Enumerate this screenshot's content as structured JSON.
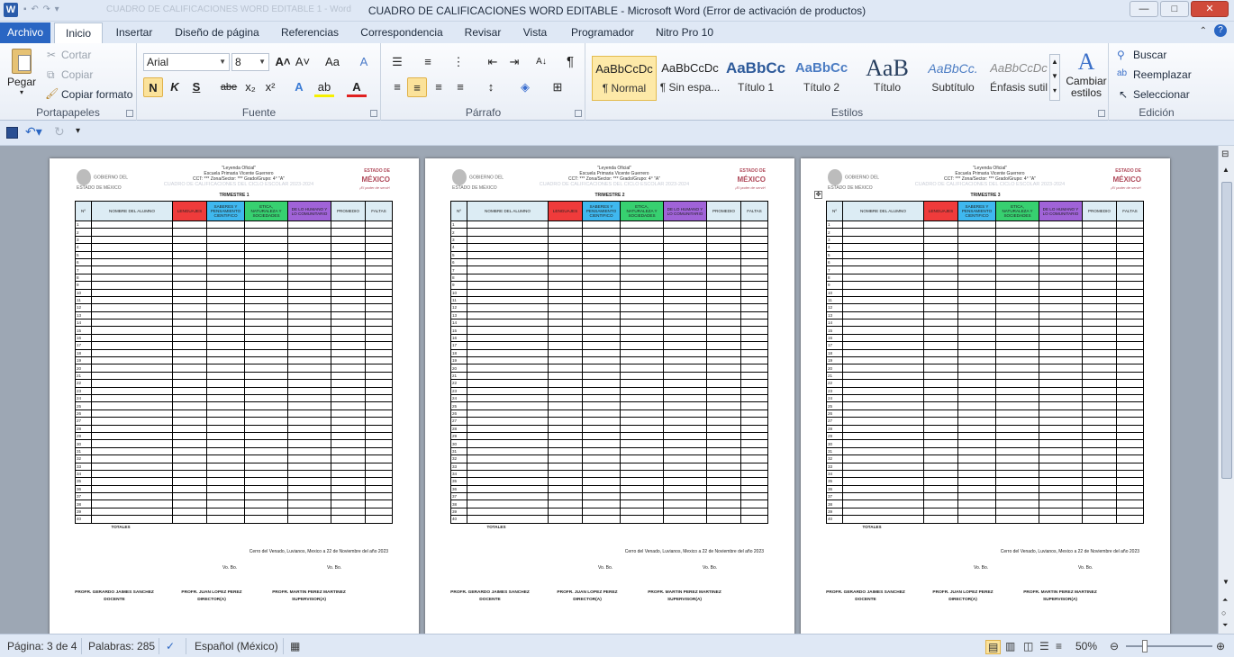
{
  "window": {
    "title": "CUADRO DE CALIFICACIONES WORD EDITABLE  -  Microsoft Word (Error de activación de productos)",
    "ghost_title": "CUADRO DE CALIFICACIONES WORD EDITABLE 1 - Word",
    "app_letter": "W",
    "btn_min": "—",
    "btn_max": "□",
    "btn_close": "✕"
  },
  "tabs": {
    "file": "Archivo",
    "items": [
      "Inicio",
      "Insertar",
      "Diseño de página",
      "Referencias",
      "Correspondencia",
      "Revisar",
      "Vista",
      "Programador",
      "Nitro Pro 10"
    ],
    "help": "⌃",
    "helpq": "?"
  },
  "ribbon": {
    "clipboard": {
      "label": "Portapapeles",
      "paste": "Pegar",
      "cut": "Cortar",
      "copy": "Copiar",
      "format_painter": "Copiar formato"
    },
    "font": {
      "label": "Fuente",
      "family": "Arial",
      "size": "8",
      "bold": "N",
      "italic": "K",
      "underline": "S",
      "strike": "abe",
      "sub": "x₂",
      "sup": "x²",
      "grow": "A˄",
      "shrink": "A˅",
      "case": "Aa",
      "clear": "A"
    },
    "paragraph": {
      "label": "Párrafo",
      "pilcrow": "¶",
      "sort": "A↓"
    },
    "styles": {
      "label": "Estilos",
      "items": [
        {
          "sample": "AaBbCcDc",
          "name": "¶ Normal"
        },
        {
          "sample": "AaBbCcDc",
          "name": "¶ Sin espa..."
        },
        {
          "sample": "AaBbCc",
          "name": "Título 1"
        },
        {
          "sample": "AaBbCc",
          "name": "Título 2"
        },
        {
          "sample": "AaB",
          "name": "Título"
        },
        {
          "sample": "AaBbCc.",
          "name": "Subtítulo"
        },
        {
          "sample": "AaBbCcDc",
          "name": "Énfasis sutil"
        }
      ],
      "change": "Cambiar estilos"
    },
    "editing": {
      "label": "Edición",
      "find": "Buscar",
      "replace": "Reemplazar",
      "select": "Seleccionar"
    }
  },
  "document": {
    "header_lines": [
      "\"Leyenda Oficial\"",
      "Escuela Primaria  Vicente Guerrero",
      "CCT: *** Zona/Sector:  *** Grado/Grupo:  4° \"A\"",
      "CUADRO DE CALIFICACIONES DEL CICLO ESCOLAR 2023-2024"
    ],
    "logo_left": "GOBIERNO DEL ESTADO DE MÉXICO",
    "logo_right_top": "ESTADO DE",
    "logo_right": "MÉXICO",
    "logo_right_sub": "¡El poder de servir!",
    "pages": [
      {
        "trimester": "TRIMESTRE  1"
      },
      {
        "trimester": "TRIMESTRE  2"
      },
      {
        "trimester": "TRIMESTRE  3"
      }
    ],
    "columns": [
      "Nº",
      "NOMBRE DEL ALUMNO",
      "LENGUAJES",
      "SABERES Y PENSAMIENTO CIENTIFICO",
      "ETICA, NATURALEZA Y SOCIEDADES",
      "DE LO HUMANO Y LO COMUNITARIO",
      "PROMEDIO",
      "FALTAS"
    ],
    "column_colors": [
      "#dcecf4",
      "#dcecf4",
      "#ef3b3b",
      "#3fb8ef",
      "#37d070",
      "#a063d8",
      "#dcecf4",
      "#dcecf4"
    ],
    "row_count": 40,
    "totals": "TOTALES",
    "place_date": "Cerro del Venado, Luvianos, Mexico a 22 de Noviembre del año 2023",
    "vobo": "Vo. Bo.",
    "signers": [
      {
        "name": "PROFR. GERARDO JAIMES SANCHEZ",
        "role": "DOCENTE"
      },
      {
        "name": "PROFR. JUAN LOPEZ PEREZ",
        "role": "DIRECTOR(A)"
      },
      {
        "name": "PROFR. MARTIN PEREZ MARTINEZ",
        "role": "SUPERVISOR(A)"
      }
    ]
  },
  "status": {
    "page": "Página: 3 de 4",
    "words": "Palabras: 285",
    "language": "Español (México)",
    "zoom": "50%"
  }
}
